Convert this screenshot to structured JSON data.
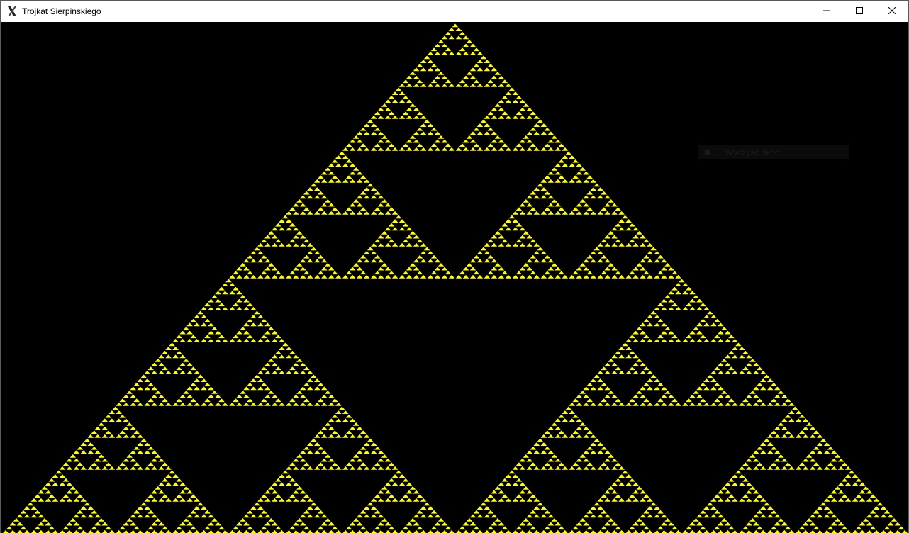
{
  "window": {
    "title": "Trojkat Sierpinskiego",
    "app_icon": "x-logo-icon",
    "controls": {
      "minimize_icon": "minimize-icon",
      "maximize_icon": "maximize-icon",
      "close_icon": "close-icon"
    }
  },
  "canvas": {
    "background_color": "#000000",
    "fractal": {
      "name": "Sierpinski triangle",
      "fill_color": "#ffff00",
      "outline_color": "#000000"
    }
  },
  "ghost_menu": {
    "label": "Wyczyść okno",
    "icon": "menu-item-icon"
  }
}
